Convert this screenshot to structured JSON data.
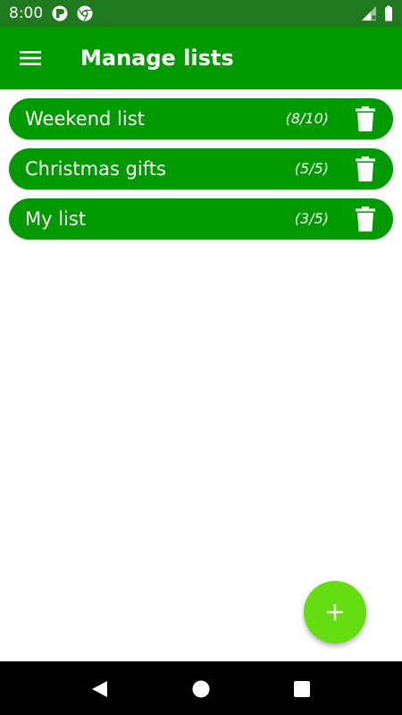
{
  "status_bar": {
    "time": "8:00",
    "left_icons": [
      "notification-app-icon",
      "chrome-icon"
    ],
    "right_icons": [
      "signal-icon",
      "battery-icon"
    ]
  },
  "app_bar": {
    "menu_icon": "hamburger-menu-icon",
    "title": "Manage lists"
  },
  "lists": [
    {
      "name": "Weekend list",
      "count": "(8/10)",
      "action_icon": "trash-icon"
    },
    {
      "name": "Christmas gifts",
      "count": "(5/5)",
      "action_icon": "trash-icon"
    },
    {
      "name": "My list",
      "count": "(3/5)",
      "action_icon": "trash-icon"
    }
  ],
  "fab": {
    "icon": "plus-icon"
  },
  "nav_bar": {
    "icons": [
      "back-icon",
      "home-icon",
      "recents-icon"
    ]
  },
  "colors": {
    "status_bar": "#1f7a1f",
    "primary": "#009900",
    "fab": "#66dd11",
    "nav_bar": "#000000",
    "text_on_primary": "#ffffff"
  }
}
